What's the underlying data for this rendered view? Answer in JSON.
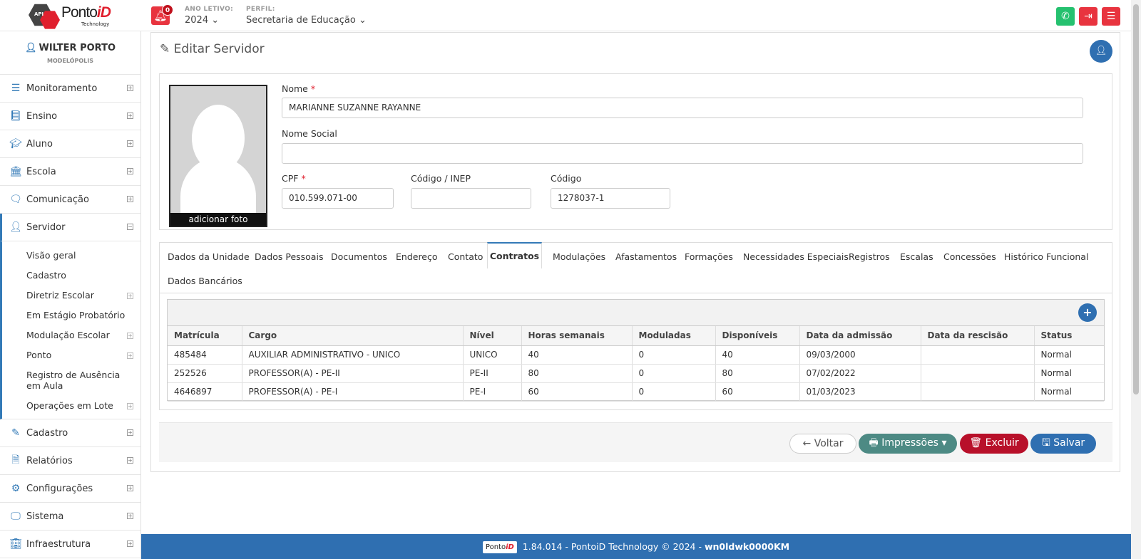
{
  "header": {
    "brand": "Ponto",
    "brand_accent": "iD",
    "brand_sub": "Technology",
    "logo_api": "API",
    "notifications": "0",
    "year_label": "ANO LETIVO:",
    "year_value": "2024",
    "profile_label": "PERFIL:",
    "profile_value": "Secretaria de Educação"
  },
  "user": {
    "name": "WILTER PORTO",
    "city": "MODELÓPOLIS"
  },
  "sidebar": {
    "items": [
      {
        "label": "Monitoramento",
        "icon": "sliders-icon"
      },
      {
        "label": "Ensino",
        "icon": "book-icon"
      },
      {
        "label": "Aluno",
        "icon": "graduation-cap-icon"
      },
      {
        "label": "Escola",
        "icon": "bank-icon"
      },
      {
        "label": "Comunicação",
        "icon": "chat-icon"
      },
      {
        "label": "Servidor",
        "icon": "user-icon"
      }
    ],
    "sub_items": [
      "Visão geral",
      "Cadastro",
      "Diretriz Escolar",
      "Em Estágio Probatório",
      "Modulação Escolar",
      "Ponto",
      "Registro de Ausência em Aula",
      "Operações em Lote"
    ],
    "items_after": [
      {
        "label": "Cadastro",
        "icon": "edit-icon"
      },
      {
        "label": "Relatórios",
        "icon": "file-icon"
      },
      {
        "label": "Configurações",
        "icon": "gear-icon"
      },
      {
        "label": "Sistema",
        "icon": "monitor-icon"
      },
      {
        "label": "Infraestrutura",
        "icon": "building-icon"
      }
    ]
  },
  "page": {
    "title": "Editar Servidor"
  },
  "form": {
    "photo_caption": "adicionar foto",
    "nome_label": "Nome",
    "nome_value": "MARIANNE SUZANNE RAYANNE",
    "nome_social_label": "Nome Social",
    "nome_social_value": "",
    "cpf_label": "CPF",
    "cpf_value": "010.599.071-00",
    "inep_label": "Código / INEP",
    "inep_value": "",
    "codigo_label": "Código",
    "codigo_value": "1278037-1"
  },
  "tabs": [
    "Dados da Unidade",
    "Dados Pessoais",
    "Documentos",
    "Endereço",
    "Contato",
    "Contratos",
    "Modulações",
    "Afastamentos",
    "Formações",
    "Necessidades Especiais",
    "Registros",
    "Escalas",
    "Concessões",
    "Histórico Funcional",
    "Dados Bancários"
  ],
  "contracts": {
    "headers": [
      "Matrícula",
      "Cargo",
      "Nível",
      "Horas semanais",
      "Moduladas",
      "Disponíveis",
      "Data da admissão",
      "Data da rescisão",
      "Status"
    ],
    "rows": [
      [
        "485484",
        "AUXILIAR ADMINISTRATIVO - UNICO",
        "UNICO",
        "40",
        "0",
        "40",
        "09/03/2000",
        "",
        "Normal"
      ],
      [
        "252526",
        "PROFESSOR(A) - PE-II",
        "PE-II",
        "80",
        "0",
        "80",
        "07/02/2022",
        "",
        "Normal"
      ],
      [
        "4646897",
        "PROFESSOR(A) - PE-I",
        "PE-I",
        "60",
        "0",
        "60",
        "01/03/2023",
        "",
        "Normal"
      ]
    ]
  },
  "actions": {
    "back": "Voltar",
    "print": "Impressões",
    "delete": "Excluir",
    "save": "Salvar"
  },
  "footer": {
    "logo_text": "Ponto",
    "logo_accent": "iD",
    "version": "1.84.014 - PontoiD Technology © 2024 - ",
    "code": "wn0ldwk0000KM"
  },
  "colors": {
    "primary": "#2f6fb1",
    "danger": "#e8343f",
    "whatsapp": "#25c16f",
    "print": "#4d8a84",
    "delete": "#b8102a"
  }
}
